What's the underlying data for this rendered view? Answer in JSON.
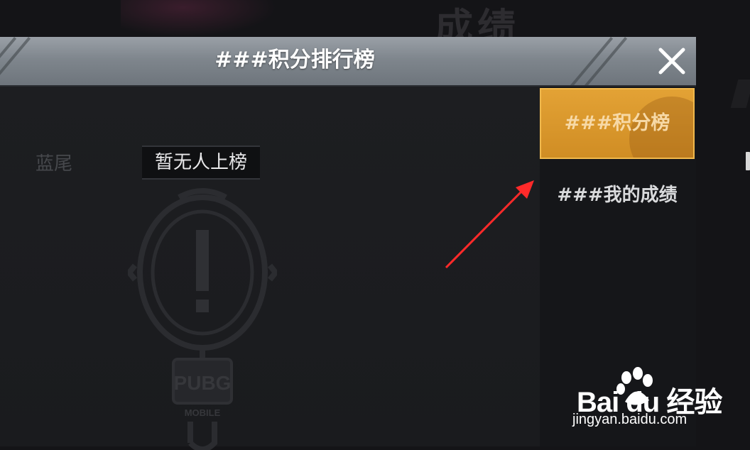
{
  "background": {
    "title": "成绩"
  },
  "dialog": {
    "title": "###积分排行榜",
    "close_icon": "close-icon"
  },
  "tabs": [
    {
      "label": "###积分榜",
      "active": true
    },
    {
      "label": "###我的成绩",
      "active": false
    }
  ],
  "content": {
    "team_label": "蓝尾",
    "empty_status": "暂无人上榜",
    "empty_icon": "frying-pan-exclamation-icon",
    "logo_text": "PUBG",
    "logo_subtext": "MOBILE"
  },
  "watermark": {
    "logo": "Bai du 经验",
    "url": "jingyan.baidu.com"
  },
  "colors": {
    "accent": "#e3a235",
    "annotation_arrow": "#ff2a2a"
  }
}
